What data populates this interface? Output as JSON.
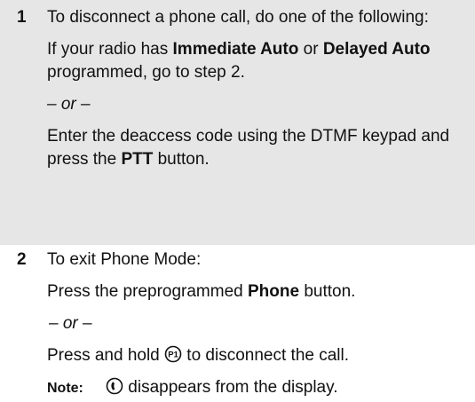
{
  "steps": [
    {
      "number": "1",
      "intro": "To disconnect a phone call, do one of the following:",
      "option_a": {
        "prefix": "If your radio has ",
        "bold_1": "Immediate Auto",
        "middle": " or ",
        "bold_2": "Delayed Auto",
        "suffix": " programmed, go to step 2."
      },
      "or_text": "– or –",
      "option_b": {
        "prefix": "Enter the deaccess code using the DTMF keypad and press the ",
        "bold": "PTT",
        "suffix": " button."
      }
    },
    {
      "number": "2",
      "intro": "To exit Phone Mode:",
      "option_a": {
        "prefix": "Press the preprogrammed ",
        "bold": "Phone",
        "suffix": " button."
      },
      "or_text": "– or –",
      "option_b": {
        "prefix": "Press and hold ",
        "icon_name": "p1-button-icon",
        "suffix": " to disconnect the call."
      },
      "note": {
        "label": "Note:",
        "icon_name": "phone-mode-indicator-icon",
        "text": " disappears from the display."
      }
    }
  ]
}
